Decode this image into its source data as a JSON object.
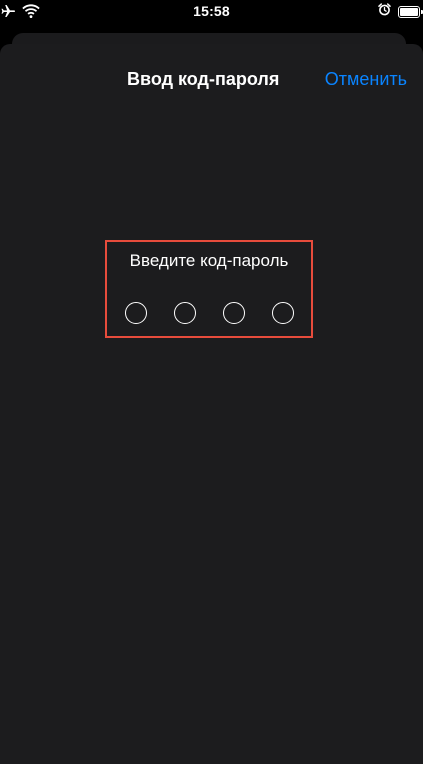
{
  "status_bar": {
    "time": "15:58",
    "left_icons": [
      "airplane-icon",
      "wifi-icon"
    ],
    "right_icons": [
      "alarm-icon",
      "battery-icon"
    ],
    "battery_level": 0.9
  },
  "sheet": {
    "title": "Ввод код-пароля",
    "cancel_label": "Отменить",
    "prompt": "Введите код-пароль",
    "digits_entered": 0,
    "digits_total": 4
  },
  "colors": {
    "accent": "#0a84ff",
    "sheet_bg": "#1c1c1e",
    "highlight_border": "#e74c3c"
  }
}
